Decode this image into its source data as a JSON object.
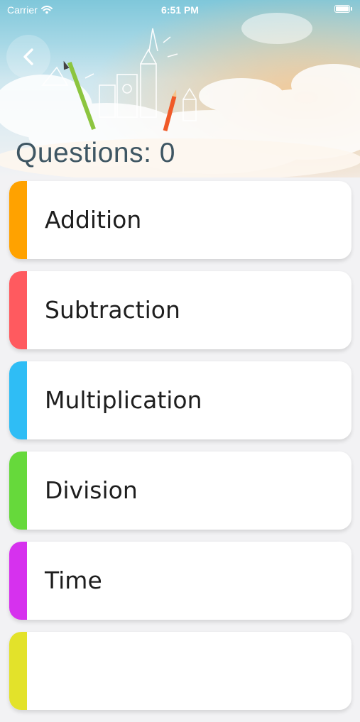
{
  "status_bar": {
    "carrier": "Carrier",
    "time": "6:51 PM",
    "icons": [
      "wifi-icon",
      "battery-icon"
    ]
  },
  "header": {
    "back_icon": "chevron-left-icon",
    "title": "Questions: 0"
  },
  "categories": [
    {
      "label": "Addition",
      "color": "#ffa200"
    },
    {
      "label": "Subtraction",
      "color": "#ff5a5f"
    },
    {
      "label": "Multiplication",
      "color": "#2fbdf5"
    },
    {
      "label": "Division",
      "color": "#66d93b"
    },
    {
      "label": "Time",
      "color": "#d631ee"
    },
    {
      "label": "",
      "color": "#e3e22a"
    }
  ]
}
